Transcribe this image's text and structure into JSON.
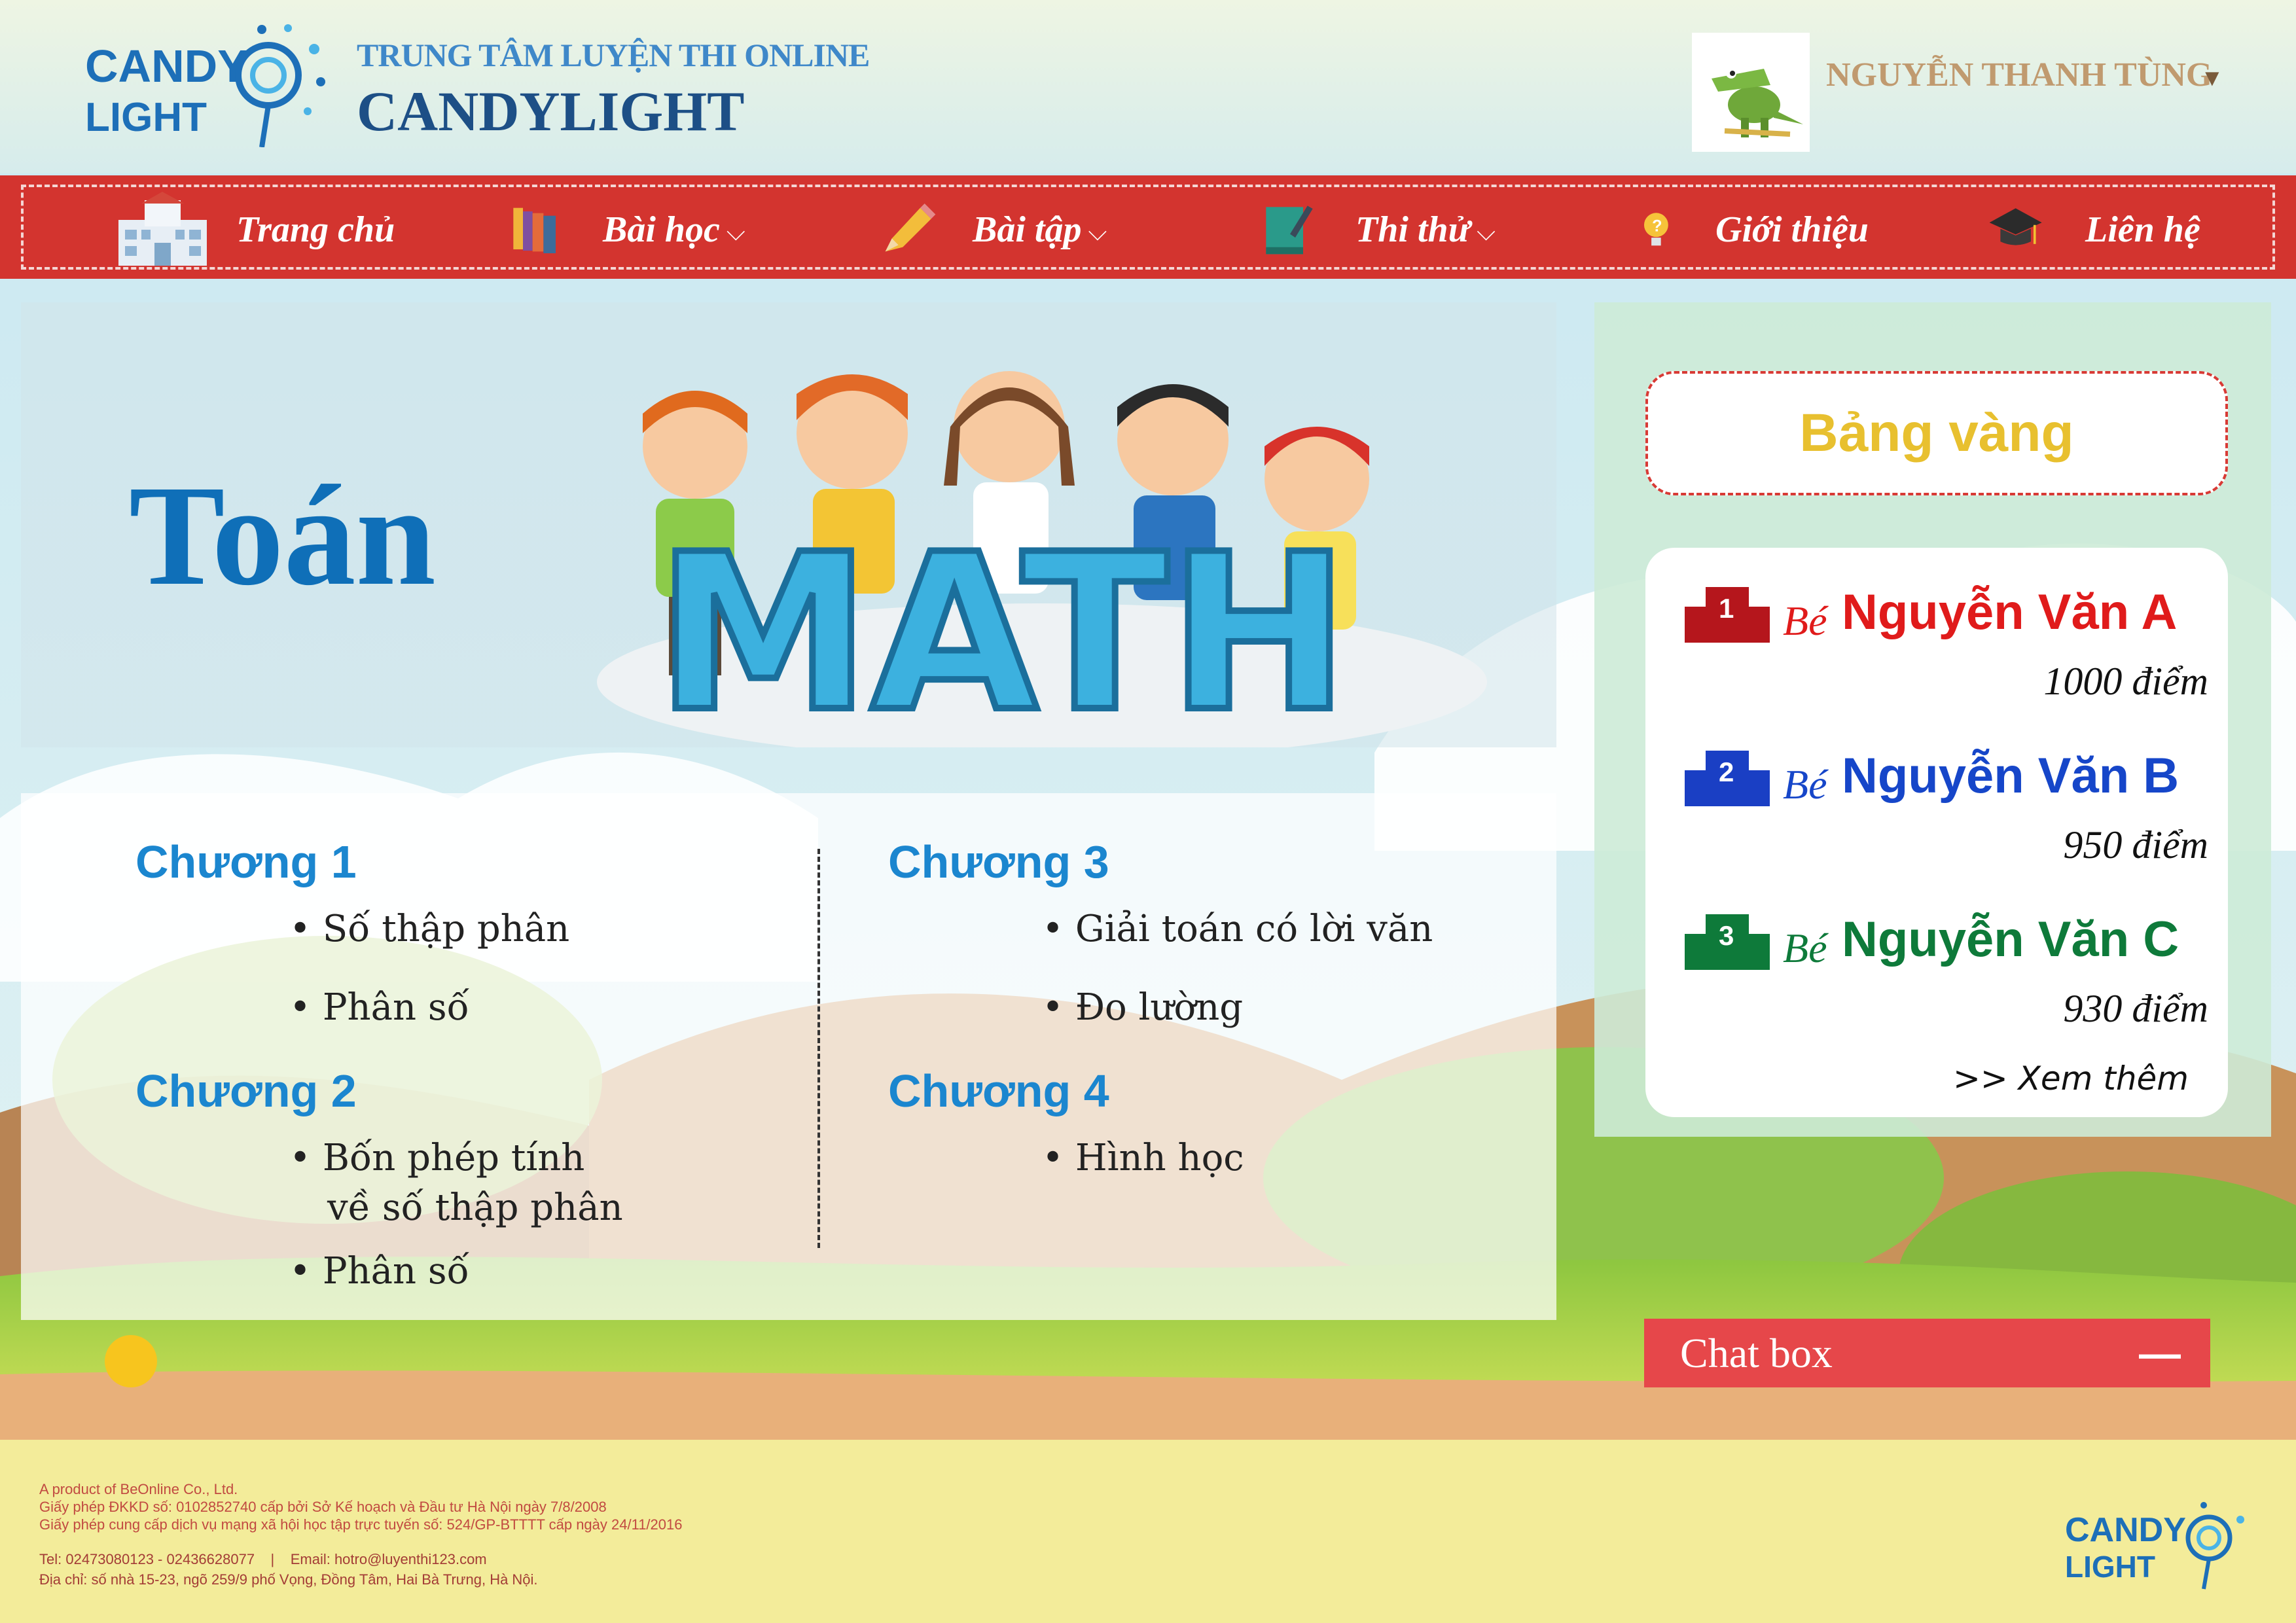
{
  "brand": {
    "subtitle": "TRUNG TÂM LUYỆN THI ONLINE",
    "name": "CANDYLIGHT",
    "logo_text_top": "CANDY",
    "logo_text_bottom": "LIGHT"
  },
  "user": {
    "name": "NGUYỄN THANH TÙNG",
    "caret": "▼",
    "avatar_icon": "crocodile-icon"
  },
  "nav": {
    "items": [
      {
        "label": "Trang chủ",
        "icon": "school-building-icon",
        "has_dropdown": false
      },
      {
        "label": "Bài học",
        "icon": "books-icon",
        "has_dropdown": true
      },
      {
        "label": "Bài tập",
        "icon": "pencil-icon",
        "has_dropdown": true
      },
      {
        "label": "Thi thử",
        "icon": "notebook-pen-icon",
        "has_dropdown": true
      },
      {
        "label": "Giới thiệu",
        "icon": "lightbulb-question-icon",
        "has_dropdown": false
      },
      {
        "label": "Liên hệ",
        "icon": "graduation-cap-icon",
        "has_dropdown": false
      }
    ],
    "chevron": "⌵"
  },
  "subject": {
    "title": "Toán",
    "banner_word": "MATH"
  },
  "chapters": [
    {
      "title": "Chương 1",
      "lessons": [
        "• Số thập phân",
        "• Phân số"
      ]
    },
    {
      "title": "Chương 2",
      "lessons": [
        "• Bốn phép tính",
        "về số thập phân",
        "• Phân số"
      ]
    },
    {
      "title": "Chương 3",
      "lessons": [
        "• Giải toán có lời văn",
        "• Đo lường"
      ]
    },
    {
      "title": "Chương 4",
      "lessons": [
        "• Hình học"
      ]
    }
  ],
  "ranking": {
    "title": "Bảng vàng",
    "prefix": "Bé",
    "entries": [
      {
        "rank": "1",
        "name": "Nguyễn Văn A",
        "score": "1000 điểm",
        "color": "#e01b1b",
        "badge_color": "#b5161c"
      },
      {
        "rank": "2",
        "name": "Nguyễn Văn B",
        "score": "950 điểm",
        "color": "#1646c9",
        "badge_color": "#1a3fc4"
      },
      {
        "rank": "3",
        "name": "Nguyễn Văn C",
        "score": "930 điểm",
        "color": "#0e7a3a",
        "badge_color": "#0e7a3a"
      }
    ],
    "see_more": ">> Xem thêm"
  },
  "chat": {
    "label": "Chat box",
    "minimize": "—"
  },
  "footer": {
    "line1": "A product of BeOnline Co., Ltd.",
    "line2": "Giấy phép ĐKKD số: 0102852740 cấp bởi Sở Kế hoạch và Đầu tư Hà Nội ngày 7/8/2008",
    "line3": "Giấy phép cung cấp dịch vụ mạng xã hội học tập trực tuyến số: 524/GP-BTTTT cấp ngày 24/11/2016",
    "phone": "Tel: 02473080123 - 02436628077",
    "separator": "|",
    "email": "Email: hotro@luyenthi123.com",
    "address": "Địa chỉ: số nhà 15-23, ngõ 259/9 phố Vọng, Đồng Tâm, Hai Bà Trưng, Hà Nội."
  }
}
